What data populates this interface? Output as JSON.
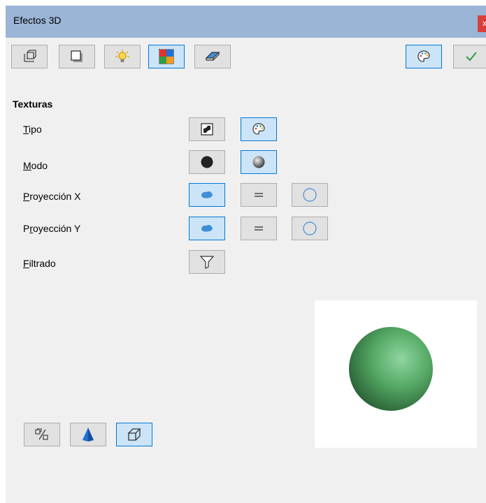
{
  "window": {
    "title": "Efectos 3D",
    "close_glyph": "x"
  },
  "toolbar": {
    "geometry_icon": "geometry-icon",
    "shading_icon": "shading-icon",
    "illumination_icon": "illumination-icon",
    "textures_icon": "textures-icon",
    "material_icon": "material-icon",
    "assign_icon": "palette-icon",
    "apply_icon": "checkmark-icon"
  },
  "textures": {
    "heading": "Texturas",
    "tipo": {
      "accel": "T",
      "rest": "ipo"
    },
    "modo": {
      "accel": "M",
      "rest": "odo"
    },
    "proj_x": {
      "accel": "P",
      "rest": "royección X"
    },
    "proj_y": {
      "pre": "P",
      "accel": "r",
      "rest": "oyección Y"
    },
    "filtrado": {
      "accel": "F",
      "rest": "iltrado"
    }
  },
  "bottom": {
    "convert_icon": "convert-to-3d-icon",
    "perspective_icon": "perspective-icon",
    "lathe_icon": "lathe-object-icon"
  },
  "colors": {
    "accent": "#0078d7",
    "active_bg": "#cce4f7",
    "titlebar": "#9bb5d7",
    "close": "#d9403a",
    "sphere": "#4caf5e"
  }
}
